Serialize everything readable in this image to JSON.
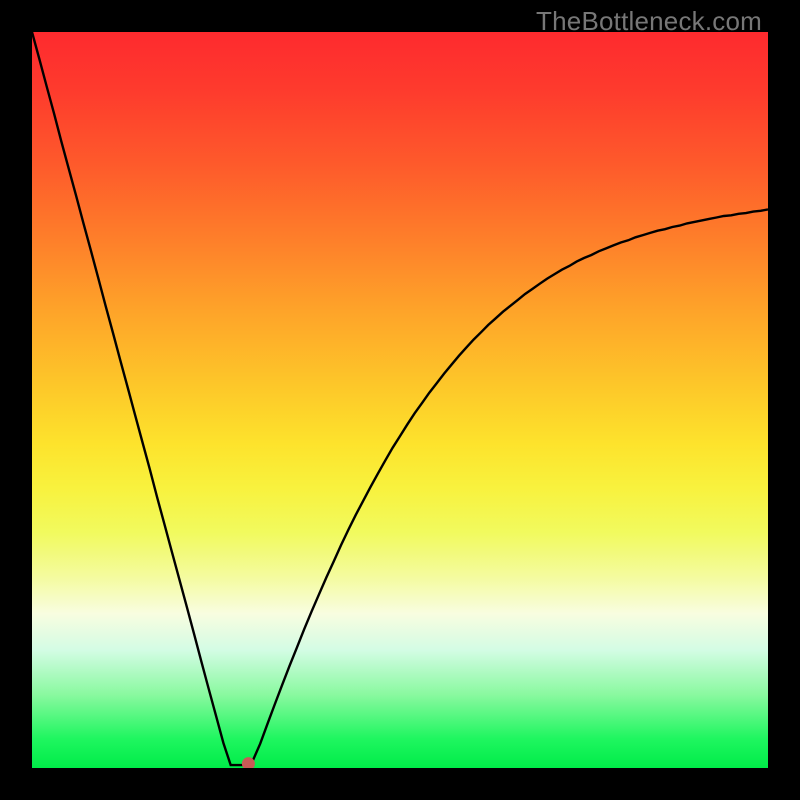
{
  "watermark": "TheBottleneck.com",
  "chart_data": {
    "type": "line",
    "title": "",
    "xlabel": "",
    "ylabel": "",
    "xlim": [
      0,
      100
    ],
    "ylim": [
      0,
      100
    ],
    "x": [
      0,
      1,
      2,
      3,
      4,
      5,
      6,
      7,
      8,
      9,
      10,
      11,
      12,
      13,
      14,
      15,
      16,
      17,
      18,
      19,
      20,
      21,
      22,
      23,
      24,
      25,
      26,
      27,
      28,
      29,
      30,
      31,
      32,
      33,
      34,
      35,
      36,
      37,
      38,
      39,
      40,
      41,
      42,
      43,
      44,
      45,
      46,
      47,
      48,
      49,
      50,
      51,
      52,
      53,
      54,
      55,
      56,
      57,
      58,
      59,
      60,
      61,
      62,
      63,
      64,
      65,
      66,
      67,
      68,
      69,
      70,
      71,
      72,
      73,
      74,
      75,
      76,
      77,
      78,
      79,
      80,
      81,
      82,
      83,
      84,
      85,
      86,
      87,
      88,
      89,
      90,
      91,
      92,
      93,
      94,
      95,
      96,
      97,
      98,
      99,
      100
    ],
    "y": [
      100,
      96.3,
      92.6,
      88.9,
      85.1,
      81.4,
      77.7,
      74,
      70.3,
      66.6,
      62.8,
      59.1,
      55.4,
      51.7,
      48,
      44.3,
      40.6,
      36.8,
      33.1,
      29.4,
      25.7,
      22,
      18.3,
      14.5,
      10.8,
      7.1,
      3.4,
      0.4,
      0.4,
      0.4,
      1,
      3.3,
      6,
      8.7,
      11.3,
      13.9,
      16.4,
      18.9,
      21.3,
      23.6,
      25.9,
      28.1,
      30.3,
      32.4,
      34.4,
      36.3,
      38.2,
      40,
      41.8,
      43.5,
      45.1,
      46.7,
      48.2,
      49.6,
      51,
      52.3,
      53.6,
      54.8,
      56,
      57.1,
      58.2,
      59.2,
      60.2,
      61.1,
      62,
      62.8,
      63.6,
      64.4,
      65.1,
      65.8,
      66.5,
      67.1,
      67.7,
      68.2,
      68.8,
      69.3,
      69.7,
      70.2,
      70.6,
      71,
      71.4,
      71.7,
      72.1,
      72.4,
      72.7,
      73,
      73.2,
      73.5,
      73.7,
      74,
      74.2,
      74.4,
      74.6,
      74.8,
      75,
      75.1,
      75.3,
      75.4,
      75.6,
      75.7,
      75.9
    ],
    "marker": {
      "x": 29.4,
      "y": 0.6
    },
    "annotations": []
  }
}
